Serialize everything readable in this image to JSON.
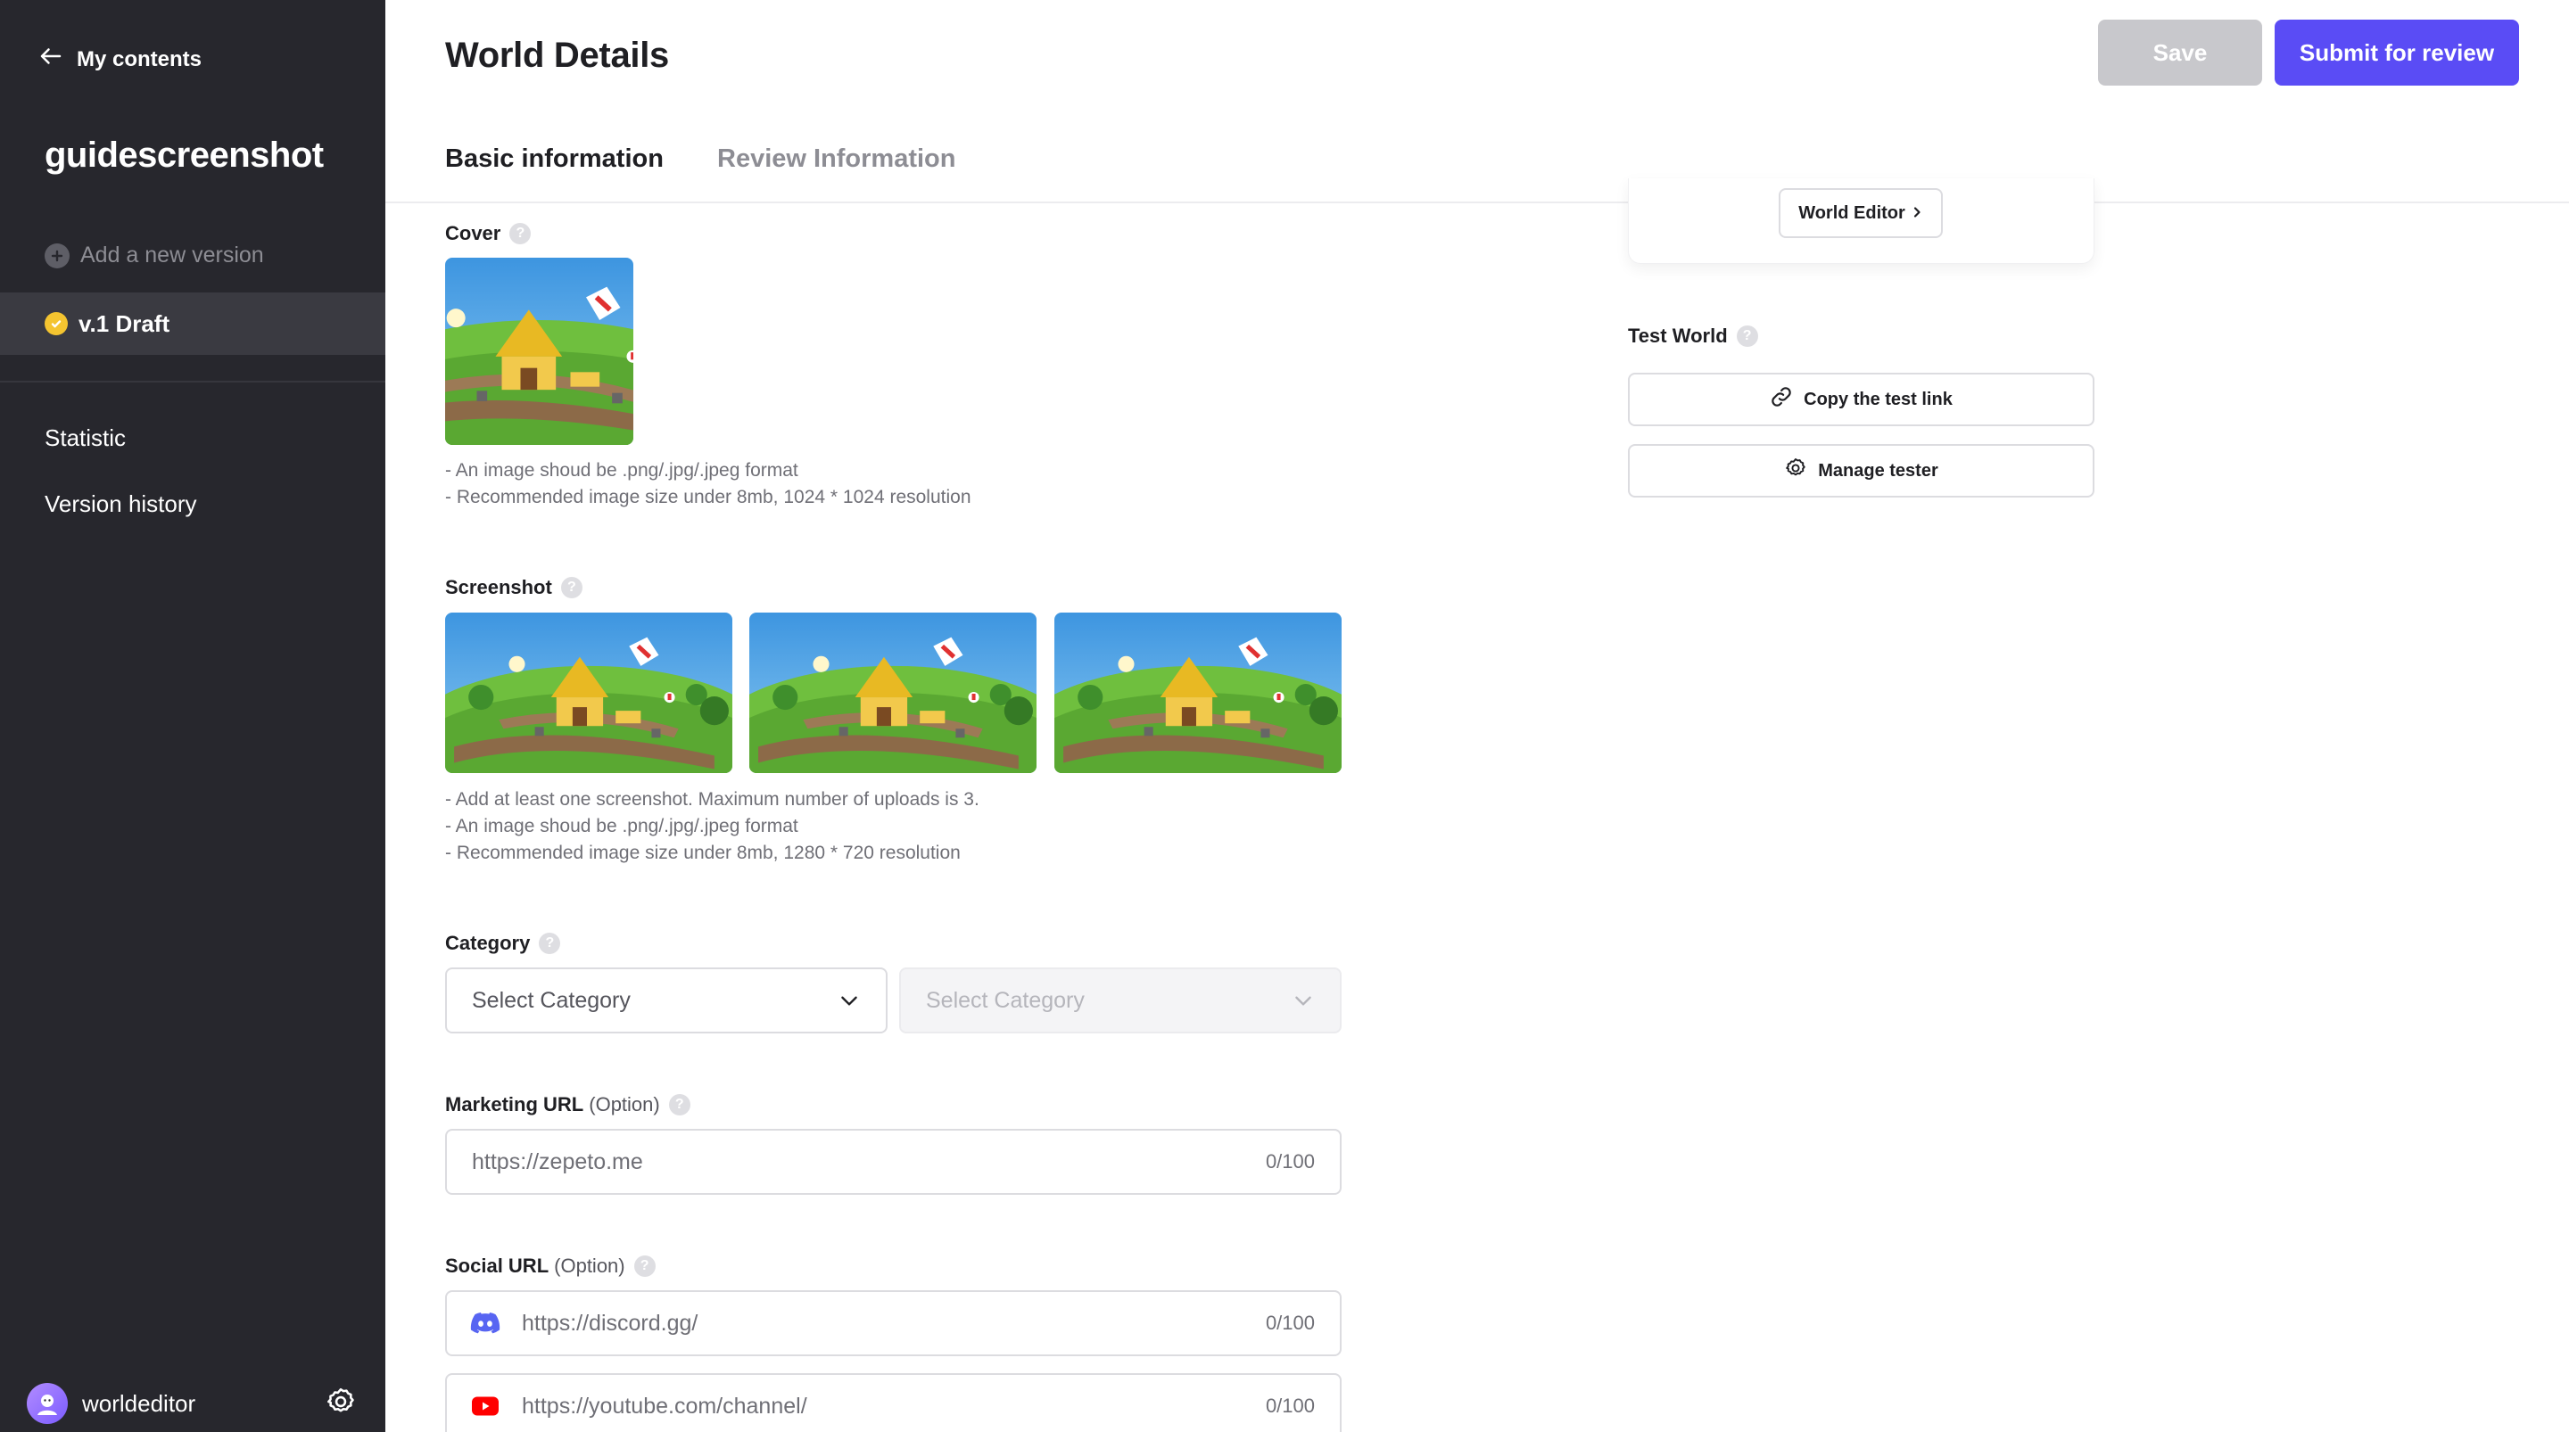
{
  "sidebar": {
    "back_label": "My contents",
    "project_name": "guidescreenshot",
    "add_version_label": "Add a new version",
    "current_version_label": "v.1 Draft",
    "nav": [
      {
        "label": "Statistic"
      },
      {
        "label": "Version history"
      }
    ],
    "user": {
      "name": "worldeditor"
    }
  },
  "header": {
    "title": "World Details",
    "save_label": "Save",
    "submit_label": "Submit for review",
    "tabs": [
      {
        "label": "Basic information",
        "active": true
      },
      {
        "label": "Review Information",
        "active": false
      }
    ]
  },
  "form": {
    "cover": {
      "label": "Cover",
      "hints": [
        "- An image shoud be .png/.jpg/.jpeg format",
        "- Recommended image size under 8mb, 1024 * 1024 resolution"
      ]
    },
    "screenshot": {
      "label": "Screenshot",
      "count": 3,
      "hints": [
        "- Add at least one screenshot. Maximum number of uploads is 3.",
        "- An image shoud be .png/.jpg/.jpeg format",
        "- Recommended image size under 8mb, 1280 * 720 resolution"
      ]
    },
    "category": {
      "label": "Category",
      "primary_placeholder": "Select Category",
      "secondary_placeholder": "Select Category"
    },
    "marketing_url": {
      "label": "Marketing URL",
      "option_label": "(Option)",
      "placeholder": "https://zepeto.me",
      "counter": "0/100"
    },
    "social_url": {
      "label": "Social URL",
      "option_label": "(Option)",
      "fields": [
        {
          "icon": "discord-icon",
          "placeholder": "https://discord.gg/",
          "counter": "0/100"
        },
        {
          "icon": "youtube-icon",
          "placeholder": "https://youtube.com/channel/",
          "counter": "0/100"
        }
      ]
    }
  },
  "right_panel": {
    "world_editor_label": "World Editor",
    "test_world_label": "Test World",
    "copy_link_label": "Copy the test link",
    "manage_tester_label": "Manage tester"
  },
  "colors": {
    "sidebar_bg": "#27272d",
    "accent": "#5a4cf5",
    "disabled_button": "#c8c8cc",
    "draft_badge": "#f4c430",
    "discord": "#5865f2",
    "youtube": "#ff0000"
  }
}
